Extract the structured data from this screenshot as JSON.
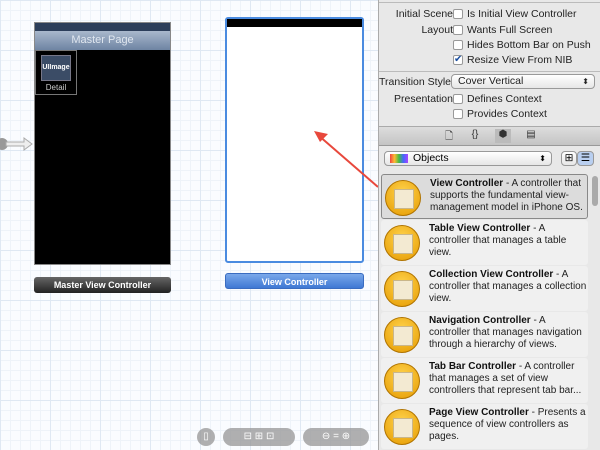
{
  "canvas": {
    "master": {
      "nav_title": "Master Page",
      "image_label": "UIImage",
      "cell_label": "Detail",
      "scene_label": "Master View Controller"
    },
    "view_controller": {
      "scene_label": "View Controller"
    }
  },
  "inspector": {
    "initial_scene": {
      "label": "Initial Scene",
      "option": "Is Initial View Controller",
      "checked": false
    },
    "layout": {
      "label": "Layout",
      "options": [
        {
          "text": "Wants Full Screen",
          "checked": false
        },
        {
          "text": "Hides Bottom Bar on Push",
          "checked": false
        },
        {
          "text": "Resize View From NIB",
          "checked": true
        }
      ]
    },
    "transition_style": {
      "label": "Transition Style",
      "value": "Cover Vertical"
    },
    "presentation": {
      "label": "Presentation",
      "options": [
        {
          "text": "Defines Context",
          "checked": false
        },
        {
          "text": "Provides Context",
          "checked": false
        }
      ]
    }
  },
  "library": {
    "filter": "Objects",
    "items": [
      {
        "title": "View Controller",
        "desc": " - A controller that supports the fundamental view-management model in iPhone OS."
      },
      {
        "title": "Table View Controller",
        "desc": " - A controller that manages a table view."
      },
      {
        "title": "Collection View Controller",
        "desc": " - A controller that manages a collection view."
      },
      {
        "title": "Navigation Controller",
        "desc": " - A controller that manages navigation through a hierarchy of views."
      },
      {
        "title": "Tab Bar Controller",
        "desc": " - A controller that manages a set of view controllers that represent tab bar..."
      },
      {
        "title": "Page View Controller",
        "desc": " - Presents a sequence of view controllers as pages."
      }
    ]
  },
  "colors": {
    "annotation_arrow": "#e8483c",
    "selection": "#4a8be0"
  }
}
